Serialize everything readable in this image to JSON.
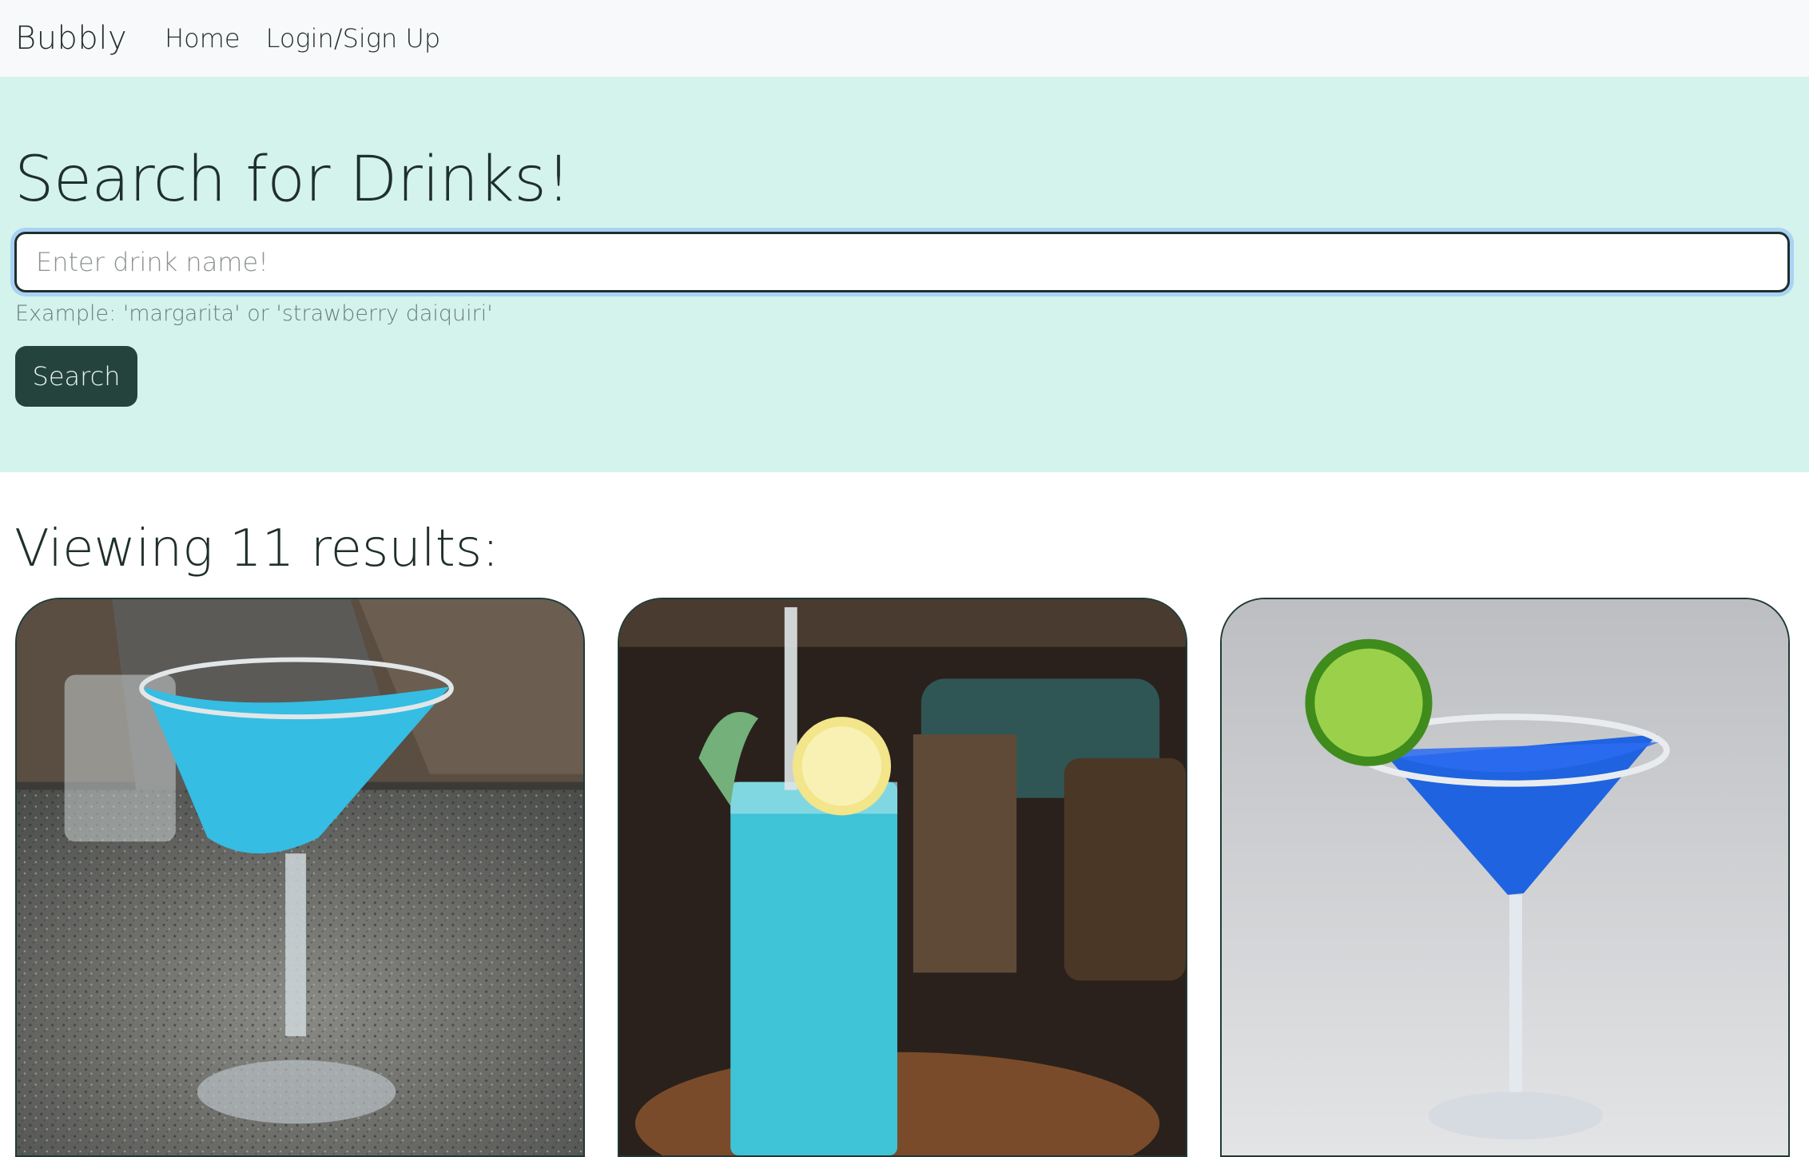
{
  "navbar": {
    "brand": "Bubbly",
    "links": [
      "Home",
      "Login/Sign Up"
    ]
  },
  "hero": {
    "title": "Search for Drinks!",
    "search_placeholder": "Enter drink name!",
    "search_value": "",
    "hint": "Example: 'margarita' or 'strawberry daiquiri'",
    "button_label": "Search"
  },
  "results": {
    "heading": "Viewing 11 results:",
    "count": 11,
    "visible_cards": [
      {
        "image": "blue-martini-on-granite-photo"
      },
      {
        "image": "blue-highball-with-lemon-photo"
      },
      {
        "image": "blue-margarita-with-lime-photo"
      }
    ]
  },
  "colors": {
    "navbar_bg": "#f8f9fa",
    "hero_bg": "#d3f3ec",
    "button_bg": "#24433d",
    "text_dark": "#1f2f2c",
    "card_border": "#1f3a35"
  }
}
